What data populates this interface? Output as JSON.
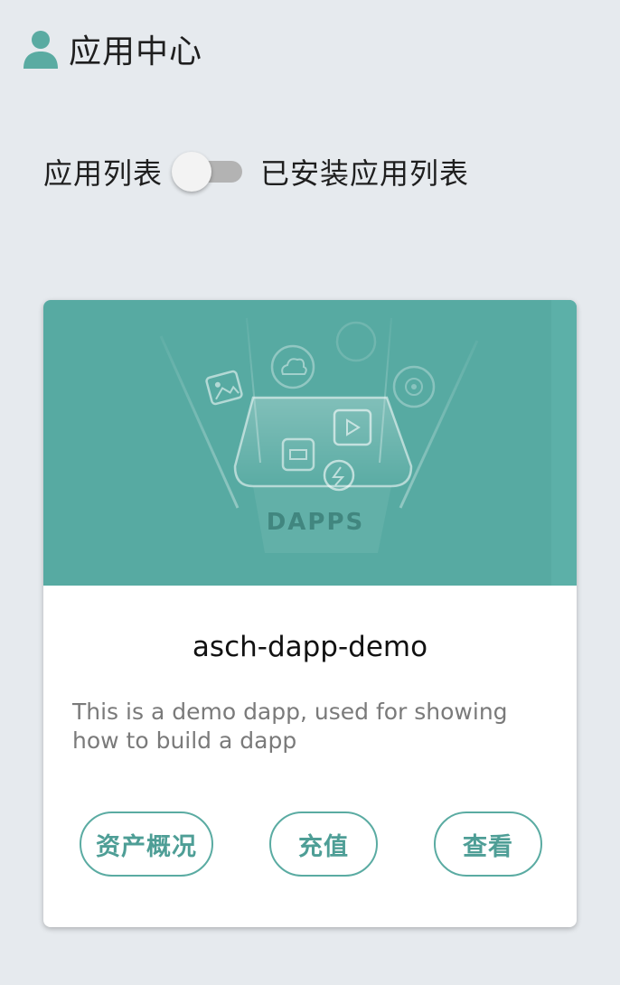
{
  "header": {
    "icon": "user-icon",
    "title": "应用中心"
  },
  "toggle": {
    "left_label": "应用列表",
    "right_label": "已安装应用列表",
    "state": "off"
  },
  "card": {
    "banner_text": "DAPPS",
    "app_name": "asch-dapp-demo",
    "description": "This is a demo dapp, used for showing how to build a dapp",
    "buttons": {
      "assets": "资产概况",
      "recharge": "充值",
      "view": "查看"
    }
  },
  "colors": {
    "accent": "#5aaba2",
    "banner": "#57aaa2",
    "background": "#e6eaee"
  }
}
